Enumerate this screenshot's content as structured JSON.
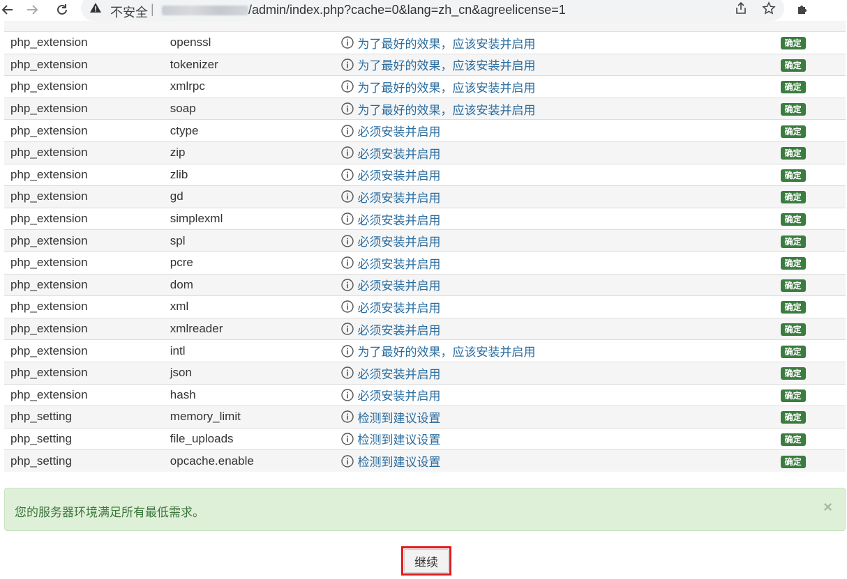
{
  "browser": {
    "security_label": "不安全",
    "separator": "|",
    "url_path": "/admin/index.php?cache=0&lang=zh_cn&agreelicense=1"
  },
  "requirements": [
    {
      "type": "php_extension",
      "name": "openssl",
      "message": "为了最好的效果，应该安装并启用",
      "status": "确定"
    },
    {
      "type": "php_extension",
      "name": "tokenizer",
      "message": "为了最好的效果，应该安装并启用",
      "status": "确定"
    },
    {
      "type": "php_extension",
      "name": "xmlrpc",
      "message": "为了最好的效果，应该安装并启用",
      "status": "确定"
    },
    {
      "type": "php_extension",
      "name": "soap",
      "message": "为了最好的效果，应该安装并启用",
      "status": "确定"
    },
    {
      "type": "php_extension",
      "name": "ctype",
      "message": "必须安装并启用",
      "status": "确定"
    },
    {
      "type": "php_extension",
      "name": "zip",
      "message": "必须安装并启用",
      "status": "确定"
    },
    {
      "type": "php_extension",
      "name": "zlib",
      "message": "必须安装并启用",
      "status": "确定"
    },
    {
      "type": "php_extension",
      "name": "gd",
      "message": "必须安装并启用",
      "status": "确定"
    },
    {
      "type": "php_extension",
      "name": "simplexml",
      "message": "必须安装并启用",
      "status": "确定"
    },
    {
      "type": "php_extension",
      "name": "spl",
      "message": "必须安装并启用",
      "status": "确定"
    },
    {
      "type": "php_extension",
      "name": "pcre",
      "message": "必须安装并启用",
      "status": "确定"
    },
    {
      "type": "php_extension",
      "name": "dom",
      "message": "必须安装并启用",
      "status": "确定"
    },
    {
      "type": "php_extension",
      "name": "xml",
      "message": "必须安装并启用",
      "status": "确定"
    },
    {
      "type": "php_extension",
      "name": "xmlreader",
      "message": "必须安装并启用",
      "status": "确定"
    },
    {
      "type": "php_extension",
      "name": "intl",
      "message": "为了最好的效果，应该安装并启用",
      "status": "确定"
    },
    {
      "type": "php_extension",
      "name": "json",
      "message": "必须安装并启用",
      "status": "确定"
    },
    {
      "type": "php_extension",
      "name": "hash",
      "message": "必须安装并启用",
      "status": "确定"
    },
    {
      "type": "php_setting",
      "name": "memory_limit",
      "message": "检测到建议设置",
      "status": "确定"
    },
    {
      "type": "php_setting",
      "name": "file_uploads",
      "message": "检测到建议设置",
      "status": "确定"
    },
    {
      "type": "php_setting",
      "name": "opcache.enable",
      "message": "检测到建议设置",
      "status": "确定"
    }
  ],
  "alert": {
    "text": "您的服务器环境满足所有最低需求。",
    "close_symbol": "×"
  },
  "continue_button": {
    "label": "继续"
  },
  "colors": {
    "message_text": "#2a6c9f",
    "badge_bg": "#3a7d3f",
    "alert_bg": "#dff0d8",
    "alert_text": "#3c763d",
    "highlight_border": "#e01b1b"
  }
}
